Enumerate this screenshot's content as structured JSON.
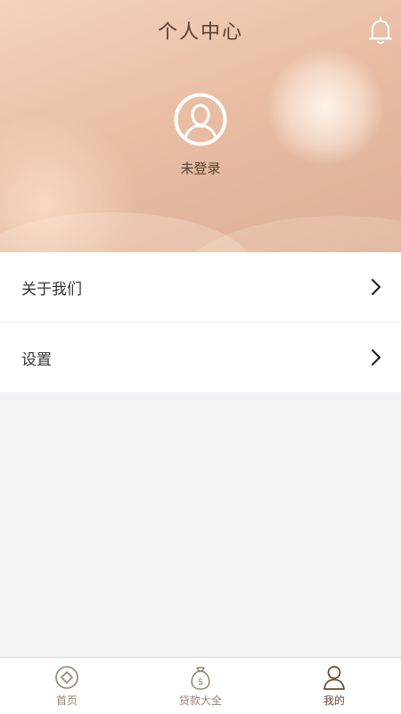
{
  "header": {
    "title": "个人中心",
    "bell_icon": "bell-icon",
    "avatar_icon": "user-avatar-icon",
    "login_status": "未登录"
  },
  "menu": {
    "items": [
      {
        "label": "关于我们",
        "icon": "chevron-right-icon"
      },
      {
        "label": "设置",
        "icon": "chevron-right-icon"
      }
    ]
  },
  "tabbar": {
    "tabs": [
      {
        "label": "首页",
        "icon": "home-diamond-icon",
        "active": false
      },
      {
        "label": "贷款大全",
        "icon": "money-bag-icon",
        "active": false
      },
      {
        "label": "我的",
        "icon": "user-icon",
        "active": true
      }
    ]
  },
  "colors": {
    "header_gradient_start": "#f3d3bf",
    "header_gradient_end": "#dcae97",
    "accent_text": "#5a4030",
    "tab_active": "#6b4a33",
    "tab_inactive": "#9a8070",
    "page_background": "#f4f3f8"
  }
}
